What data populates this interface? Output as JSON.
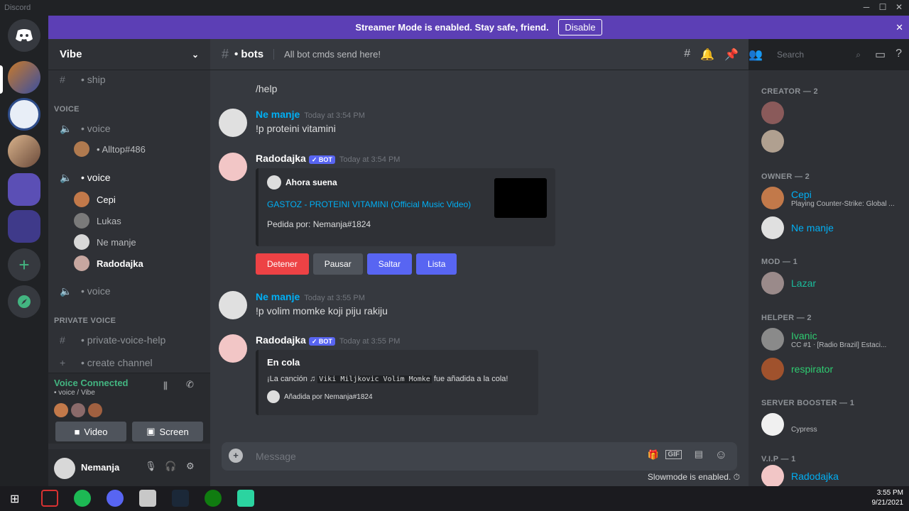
{
  "app": {
    "title": "Discord"
  },
  "banner": {
    "text": "Streamer Mode is enabled. Stay safe, friend.",
    "button": "Disable"
  },
  "server": {
    "name": "Vibe"
  },
  "channels": {
    "top": {
      "name": "• ship"
    },
    "voice_category": "VOICE",
    "voice1": "• voice",
    "voice1_user": "• Alltop#486",
    "voice2": "• voice",
    "voice2_users": [
      "Cepi",
      "Lukas",
      "Ne manje",
      "Radodajka"
    ],
    "voice3": "• voice",
    "private_category": "PRIVATE VOICE",
    "private_help": "• private-voice-help",
    "create": "• create channel"
  },
  "voice_connected": {
    "status": "Voice Connected",
    "sub": "• voice / Vibe",
    "video": "Video",
    "screen": "Screen"
  },
  "user": {
    "name": "Nemanja"
  },
  "chat": {
    "channel": "• bots",
    "topic": "All bot cmds send here!",
    "search_placeholder": "Search",
    "messages": [
      {
        "text": "/help"
      },
      {
        "author": "Ne manje",
        "time": "Today at 3:54 PM",
        "text": "!p proteini vitamini"
      },
      {
        "author": "Radodajka",
        "bot": "✓ BOT",
        "time": "Today at 3:54 PM",
        "embed": {
          "title": "Ahora suena",
          "link": "GASTOZ - PROTEINI VITAMINI (Official Music Video)",
          "footer": "Pedida por: Nemanja#1824"
        },
        "buttons": [
          "Detener",
          "Pausar",
          "Saltar",
          "Lista"
        ]
      },
      {
        "author": "Ne manje",
        "time": "Today at 3:55 PM",
        "text": "!p volim momke koji piju rakiju"
      },
      {
        "author": "Radodajka",
        "bot": "✓ BOT",
        "time": "Today at 3:55 PM",
        "embed": {
          "title": "En cola",
          "text_prefix": "¡La canción",
          "song": "Viki Miljkovic Volim Momke",
          "text_suffix": "fue añadida a la cola!",
          "footer": "Añadida por Nemanja#1824"
        }
      }
    ],
    "composer_placeholder": "Message",
    "slowmode": "Slowmode is enabled."
  },
  "members": {
    "groups": [
      {
        "label": "CREATOR — 2"
      },
      {
        "label": "OWNER — 2",
        "members": [
          {
            "name": "Cepi",
            "status": "Playing Counter-Strike: Global ..."
          },
          {
            "name": "Ne manje"
          }
        ]
      },
      {
        "label": "MOD — 1",
        "members": [
          {
            "name": "Lazar"
          }
        ]
      },
      {
        "label": "HELPER — 2",
        "members": [
          {
            "name": "Ivanic",
            "status": "CC #1 ᐧ [Radio Brazil] Estaci..."
          },
          {
            "name": "respirator"
          }
        ]
      },
      {
        "label": "SERVER BOOSTER — 1",
        "members": [
          {
            "name": "Cypress"
          }
        ]
      },
      {
        "label": "V.I.P — 1",
        "members": [
          {
            "name": "Radodajka"
          }
        ]
      }
    ]
  },
  "taskbar": {
    "time": "3:55 PM",
    "date": "9/21/2021"
  },
  "colors": {
    "accent": "#5865f2",
    "banner": "#5c3fb5",
    "green": "#43b581",
    "danger": "#ed4245",
    "link": "#00aff4"
  }
}
